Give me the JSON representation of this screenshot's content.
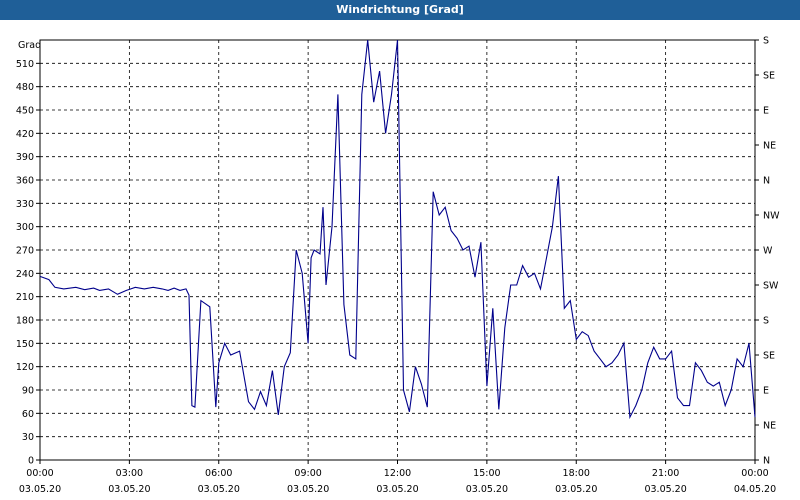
{
  "window": {
    "title": "Windrichtung [Grad]"
  },
  "chart_data": {
    "type": "line",
    "title": "Windrichtung [Grad]",
    "ylabel": "Grad",
    "ylim": [
      0,
      540
    ],
    "y_ticks": [
      0,
      30,
      60,
      90,
      120,
      150,
      180,
      210,
      240,
      270,
      300,
      330,
      360,
      390,
      420,
      450,
      480,
      510
    ],
    "xlim": [
      0,
      24
    ],
    "x_ticks": [
      {
        "time": "00:00",
        "date": "03.05.20"
      },
      {
        "time": "03:00",
        "date": "03.05.20"
      },
      {
        "time": "06:00",
        "date": "03.05.20"
      },
      {
        "time": "09:00",
        "date": "03.05.20"
      },
      {
        "time": "12:00",
        "date": "03.05.20"
      },
      {
        "time": "15:00",
        "date": "03.05.20"
      },
      {
        "time": "18:00",
        "date": "03.05.20"
      },
      {
        "time": "21:00",
        "date": "03.05.20"
      },
      {
        "time": "00:00",
        "date": "04.05.20"
      }
    ],
    "right_axis_labels": [
      "N",
      "NE",
      "E",
      "SE",
      "S",
      "SW",
      "W",
      "NW",
      "N",
      "NE",
      "E",
      "SE",
      "S"
    ],
    "grid": true,
    "line_color": "#00008b",
    "series": [
      {
        "x": [
          0.0,
          0.3,
          0.5,
          0.8,
          1.2,
          1.5,
          1.8,
          2.0,
          2.3,
          2.6,
          2.9,
          3.2,
          3.5,
          3.8,
          4.1,
          4.3,
          4.5,
          4.7,
          4.9,
          5.0,
          5.1,
          5.2,
          5.4,
          5.7,
          5.9,
          6.0,
          6.2,
          6.4,
          6.7,
          7.0,
          7.2,
          7.4,
          7.6,
          7.8,
          8.0,
          8.2,
          8.4,
          8.6,
          8.8,
          9.0,
          9.1,
          9.2,
          9.4,
          9.5,
          9.6,
          9.8,
          10.0,
          10.2,
          10.4,
          10.6,
          10.8,
          11.0,
          11.2,
          11.4,
          11.6,
          11.8,
          12.0,
          12.2,
          12.4,
          12.6,
          12.8,
          13.0,
          13.2,
          13.4,
          13.6,
          13.8,
          14.0,
          14.2,
          14.4,
          14.6,
          14.8,
          15.0,
          15.2,
          15.4,
          15.6,
          15.8,
          16.0,
          16.2,
          16.4,
          16.6,
          16.8,
          17.0,
          17.2,
          17.4,
          17.6,
          17.8,
          18.0,
          18.2,
          18.4,
          18.6,
          18.8,
          19.0,
          19.2,
          19.4,
          19.6,
          19.8,
          20.0,
          20.2,
          20.4,
          20.6,
          20.8,
          21.0,
          21.2,
          21.4,
          21.6,
          21.8,
          22.0,
          22.2,
          22.4,
          22.6,
          22.8,
          23.0,
          23.2,
          23.4,
          23.6,
          23.8,
          24.0
        ],
        "y": [
          236,
          232,
          222,
          220,
          222,
          219,
          221,
          218,
          220,
          213,
          218,
          222,
          220,
          222,
          220,
          218,
          221,
          218,
          220,
          212,
          70,
          68,
          205,
          197,
          68,
          125,
          150,
          135,
          140,
          75,
          65,
          88,
          70,
          115,
          58,
          120,
          138,
          270,
          240,
          150,
          260,
          270,
          265,
          325,
          225,
          300,
          470,
          200,
          135,
          130,
          470,
          540,
          460,
          500,
          420,
          470,
          540,
          90,
          62,
          120,
          98,
          68,
          345,
          315,
          325,
          295,
          285,
          270,
          275,
          235,
          280,
          95,
          195,
          65,
          170,
          225,
          225,
          250,
          235,
          240,
          220,
          260,
          300,
          365,
          195,
          205,
          155,
          165,
          160,
          140,
          130,
          120,
          125,
          135,
          150,
          55,
          70,
          90,
          125,
          145,
          130,
          130,
          140,
          80,
          70,
          70,
          125,
          115,
          100,
          95,
          100,
          70,
          90,
          130,
          120,
          150,
          55
        ]
      }
    ]
  }
}
